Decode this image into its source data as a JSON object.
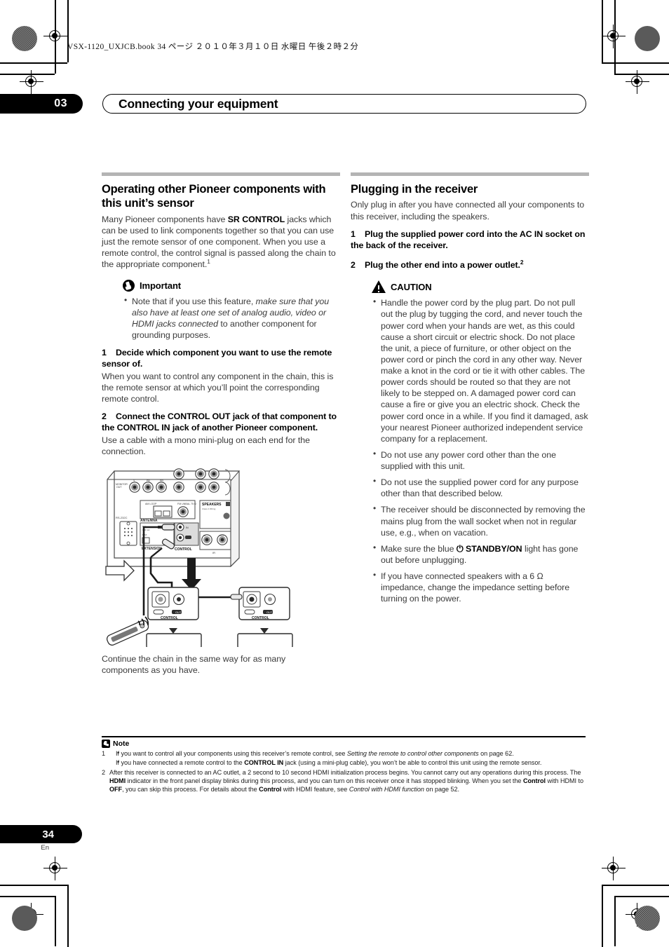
{
  "print_header": "VSX-1120_UXJCB.book   34 ページ   ２０１０年３月１０日   水曜日   午後２時２分",
  "chapter": {
    "number": "03",
    "title": "Connecting your equipment"
  },
  "left_column": {
    "heading": "Operating other Pioneer components with this unit’s sensor",
    "intro_1": "Many Pioneer components have ",
    "intro_kw": "SR CONTROL",
    "intro_2": " jacks which can be used to link components together so that you can use just the remote sensor of one component. When you use a remote control, the control signal is passed along the chain to the appropriate component.",
    "intro_sup": "1",
    "important": {
      "icon": "important-icon",
      "label": "Important",
      "bullets": [
        {
          "plain_1": "Note that if you use this feature, ",
          "italic": "make sure that you also have at least one set of analog audio, video or HDMI jacks connected",
          "plain_2": " to another component for grounding purposes."
        }
      ]
    },
    "step1": {
      "number": "1",
      "title": "Decide which component you want to use the remote sensor of.",
      "body": "When you want to control any component in the chain, this is the remote sensor at which you’ll point the corresponding remote control."
    },
    "step2": {
      "number": "2",
      "title": "Connect the CONTROL OUT jack of that component to the CONTROL IN jack of another Pioneer component.",
      "body": "Use a cable with a mono mini-plug on each end for the connection."
    },
    "figure": {
      "name": "control-chain-diagram",
      "rear_panel_labels": [
        "MONITOR OUT",
        "Y",
        "PB",
        "PR",
        "RS-232C",
        "ANTENNA",
        "AM LOOP",
        "FM UNBAL 75Ω",
        "SPEAKERS B",
        "Class 2 Wiring",
        "EXTENSION",
        "CONTROL",
        "IR",
        "IN",
        "OUT"
      ],
      "component_labels": [
        "CONTROL",
        "IN",
        "OUT"
      ],
      "remote_label": "remote-control"
    },
    "closing": "Continue the chain in the same way for as many components as you have."
  },
  "right_column": {
    "heading": "Plugging in the receiver",
    "intro": "Only plug in after you have connected all your components to this receiver, including the speakers.",
    "step1": {
      "number": "1",
      "title": "Plug the supplied power cord into the AC IN socket on the back of the receiver."
    },
    "step2": {
      "number": "2",
      "title": "Plug the other end into a power outlet.",
      "sup": "2"
    },
    "caution": {
      "icon": "caution-icon",
      "label": "CAUTION",
      "bullets": [
        "Handle the power cord by the plug part. Do not pull out the plug by tugging the cord, and never touch the power cord when your hands are wet, as this could cause a short circuit or electric shock. Do not place the unit, a piece of furniture, or other object on the power cord or pinch the cord in any other way. Never make a knot in the cord or tie it with other cables. The power cords should be routed so that they are not likely to be stepped on. A damaged power cord can cause a fire or give you an electric shock. Check the power cord once in a while. If you find it damaged, ask your nearest Pioneer authorized independent service company for a replacement.",
        "Do not use any power cord other than the one supplied with this unit.",
        "Do not use the supplied power cord for any purpose other than that described below.",
        "The receiver should be disconnected by removing the mains plug from the wall socket when not in regular use, e.g., when on vacation."
      ],
      "bullet_standby": {
        "plain_1": "Make sure the blue ",
        "symbol": "⏻",
        "keyword": "STANDBY/ON",
        "plain_2": " light has gone out before unplugging."
      },
      "bullet_impedance": {
        "plain_1": "If you have connected speakers with a 6 ",
        "symbol": "Ω",
        "plain_2": " impedance, change the impedance setting before turning on the power."
      }
    }
  },
  "notes": {
    "icon": "note-icon",
    "label": "Note",
    "items": [
      {
        "number": "1",
        "sub_bullets": [
          {
            "plain_1": "If you want to control all your components using this receiver’s remote control, see ",
            "italic": "Setting the remote to control other components",
            "plain_2": " on page 62."
          },
          {
            "plain_1": "If you have connected a remote control to the ",
            "keyword": "CONTROL IN",
            "plain_2": " jack (using a mini-plug cable), you won’t be able to control this unit using the remote sensor."
          }
        ]
      },
      {
        "number": "2",
        "text_1": "After this receiver is connected to an AC outlet, a 2 second to 10 second HDMI initialization process begins. You cannot carry out any operations during this process. The ",
        "kw_1": "HDMI",
        "text_2": " indicator in the front panel display blinks during this process, and you can turn on this receiver once it has stopped blinking. When you set the ",
        "kw_2": "Control",
        "text_3": " with HDMI to ",
        "kw_3": "OFF",
        "text_4": ", you can skip this process. For details about the ",
        "kw_4": "Control",
        "text_5": " with HDMI feature, see ",
        "italic_1": "Control with HDMI function",
        "text_6": " on page 52."
      }
    ]
  },
  "footer": {
    "page_number": "34",
    "language": "En"
  },
  "colors": {
    "rule_gray": "#b4b4b4",
    "body_text": "#3b3b3b",
    "heading_black": "#000000"
  }
}
